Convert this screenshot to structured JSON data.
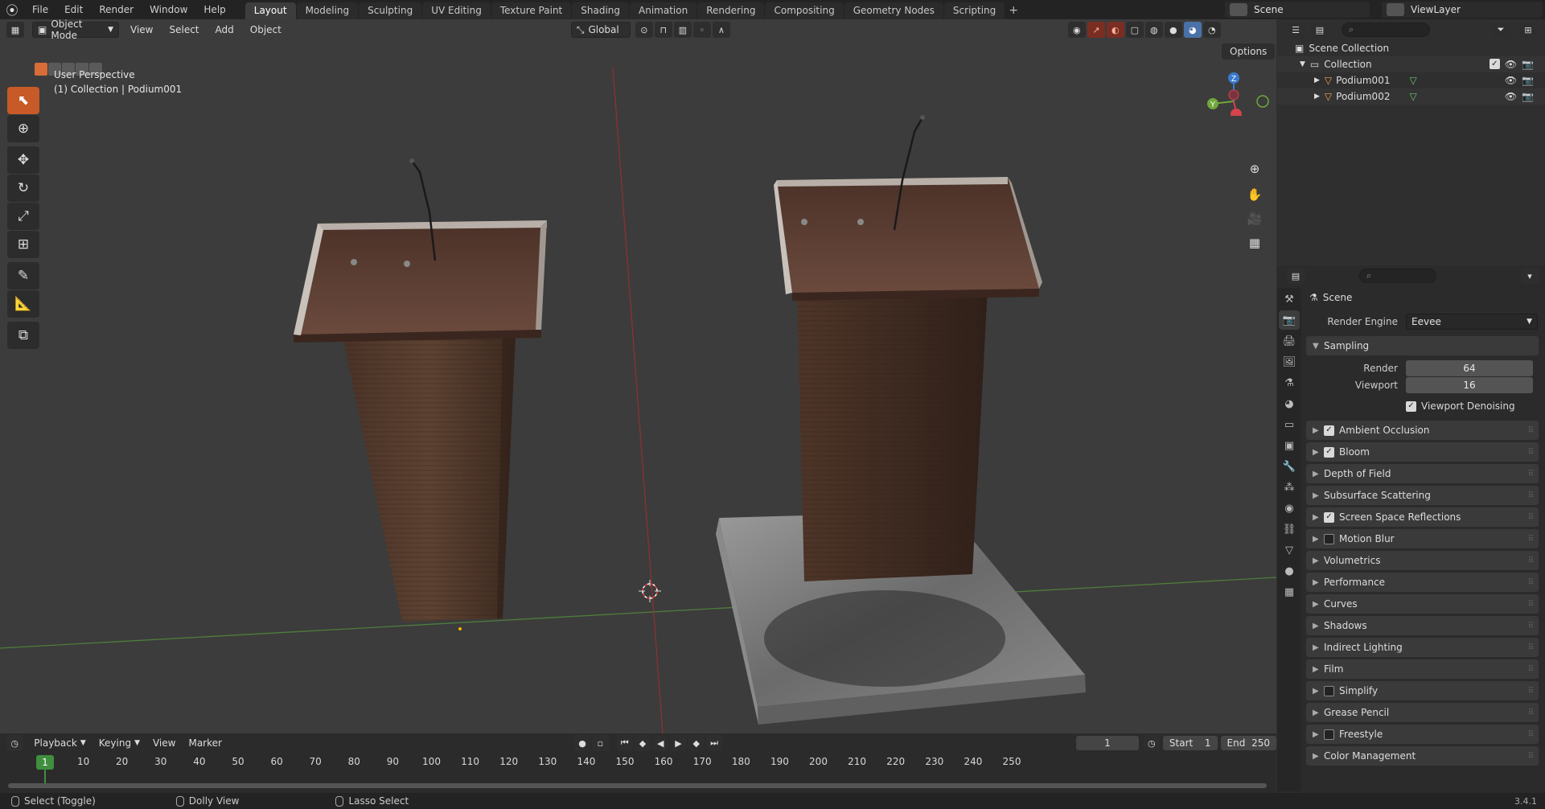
{
  "topbar": {
    "menus": [
      "File",
      "Edit",
      "Render",
      "Window",
      "Help"
    ],
    "tabs": [
      "Layout",
      "Modeling",
      "Sculpting",
      "UV Editing",
      "Texture Paint",
      "Shading",
      "Animation",
      "Rendering",
      "Compositing",
      "Geometry Nodes",
      "Scripting"
    ],
    "add_tab": "+",
    "scene": "Scene",
    "view_layer": "ViewLayer"
  },
  "viewport": {
    "mode": "Object Mode",
    "menus": [
      "View",
      "Select",
      "Add",
      "Object"
    ],
    "transform_orientation": "Global",
    "options": "Options",
    "perspective": "User Perspective",
    "collection_info": "(1) Collection | Podium001",
    "gizmo_axes": {
      "x": "X",
      "y": "Y",
      "z": "Z"
    },
    "axis_colors": {
      "x": "#d5434c",
      "y": "#6fa739",
      "z": "#3a7ad0"
    }
  },
  "timeline": {
    "menus": [
      "Playback",
      "Keying",
      "View",
      "Marker"
    ],
    "current_frame": "1",
    "start_label": "Start",
    "start": "1",
    "end_label": "End",
    "end": "250",
    "ticks": [
      "10",
      "20",
      "30",
      "40",
      "50",
      "60",
      "70",
      "80",
      "90",
      "100",
      "110",
      "120",
      "130",
      "140",
      "150",
      "160",
      "170",
      "180",
      "190",
      "200",
      "210",
      "220",
      "230",
      "240",
      "250"
    ],
    "ruler_current": "1"
  },
  "outliner": {
    "root": "Scene Collection",
    "collection": "Collection",
    "objects": [
      "Podium001",
      "Podium002"
    ]
  },
  "properties": {
    "context": "Scene",
    "render_engine_label": "Render Engine",
    "render_engine": "Eevee",
    "sampling_label": "Sampling",
    "render_label": "Render",
    "render_samples": "64",
    "viewport_label": "Viewport",
    "viewport_samples": "16",
    "viewport_denoising": "Viewport Denoising",
    "panels": [
      {
        "label": "Ambient Occlusion",
        "checkbox": true,
        "checked": true
      },
      {
        "label": "Bloom",
        "checkbox": true,
        "checked": true
      },
      {
        "label": "Depth of Field",
        "checkbox": false
      },
      {
        "label": "Subsurface Scattering",
        "checkbox": false
      },
      {
        "label": "Screen Space Reflections",
        "checkbox": true,
        "checked": true
      },
      {
        "label": "Motion Blur",
        "checkbox": true,
        "checked": false
      },
      {
        "label": "Volumetrics",
        "checkbox": false
      },
      {
        "label": "Performance",
        "checkbox": false
      },
      {
        "label": "Curves",
        "checkbox": false
      },
      {
        "label": "Shadows",
        "checkbox": false
      },
      {
        "label": "Indirect Lighting",
        "checkbox": false
      },
      {
        "label": "Film",
        "checkbox": false
      },
      {
        "label": "Simplify",
        "checkbox": true,
        "checked": false
      },
      {
        "label": "Grease Pencil",
        "checkbox": false
      },
      {
        "label": "Freestyle",
        "checkbox": true,
        "checked": false
      },
      {
        "label": "Color Management",
        "checkbox": false
      }
    ]
  },
  "statusbar": {
    "select": "Select (Toggle)",
    "dolly": "Dolly View",
    "lasso": "Lasso Select",
    "version": "3.4.1"
  }
}
